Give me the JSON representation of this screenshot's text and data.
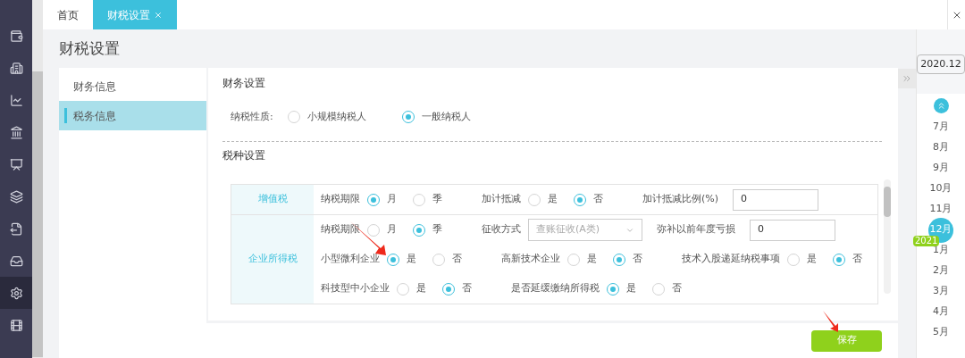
{
  "sidebar": {
    "items": [
      {
        "kind": "bag",
        "selected": false
      },
      {
        "kind": "building",
        "selected": false
      },
      {
        "kind": "chart",
        "selected": false
      },
      {
        "kind": "register",
        "selected": false
      },
      {
        "kind": "board",
        "selected": false
      },
      {
        "kind": "stack",
        "selected": false
      },
      {
        "kind": "export",
        "selected": false
      },
      {
        "kind": "inbox",
        "selected": false
      },
      {
        "kind": "gear",
        "selected": true
      },
      {
        "kind": "video",
        "selected": false
      }
    ]
  },
  "tabs": [
    {
      "label": "首页",
      "selected": false,
      "closable": false
    },
    {
      "label": "财税设置",
      "selected": true,
      "closable": true
    }
  ],
  "page_title": "财税设置",
  "left_menu": [
    {
      "label": "财务信息",
      "selected": false
    },
    {
      "label": "税务信息",
      "selected": true
    }
  ],
  "finance_section": {
    "title": "财务设置",
    "taxpayer_type": {
      "label": "纳税性质:",
      "options": [
        {
          "label": "小规模纳税人",
          "selected": false
        },
        {
          "label": "一般纳税人",
          "selected": true
        }
      ]
    }
  },
  "tax_section": {
    "title": "税种设置",
    "taxes": [
      {
        "name": "增值税",
        "lines": [
          [
            {
              "kind": "radio",
              "label": "纳税期限",
              "options": [
                {
                  "label": "月",
                  "selected": true
                },
                {
                  "label": "季",
                  "selected": false
                }
              ]
            },
            {
              "kind": "radio",
              "label": "加计抵减",
              "options": [
                {
                  "label": "是",
                  "selected": false
                },
                {
                  "label": "否",
                  "selected": true
                }
              ]
            },
            {
              "kind": "input",
              "label": "加计抵减比例(%)",
              "value": "0"
            }
          ]
        ]
      },
      {
        "name": "企业所得税",
        "lines": [
          [
            {
              "kind": "radio",
              "label": "纳税期限",
              "options": [
                {
                  "label": "月",
                  "selected": false
                },
                {
                  "label": "季",
                  "selected": true
                }
              ]
            },
            {
              "kind": "select",
              "label": "征收方式",
              "value": "查账征收(A类)"
            },
            {
              "kind": "input",
              "label": "弥补以前年度亏损",
              "value": "0"
            }
          ],
          [
            {
              "kind": "radio",
              "label": "小型微利企业",
              "options": [
                {
                  "label": "是",
                  "selected": true
                },
                {
                  "label": "否",
                  "selected": false
                }
              ]
            },
            {
              "kind": "radio",
              "label": "高新技术企业",
              "options": [
                {
                  "label": "是",
                  "selected": false
                },
                {
                  "label": "否",
                  "selected": true
                }
              ]
            },
            {
              "kind": "radio",
              "label": "技术入股递延纳税事项",
              "options": [
                {
                  "label": "是",
                  "selected": false
                },
                {
                  "label": "否",
                  "selected": true
                }
              ]
            }
          ],
          [
            {
              "kind": "radio",
              "label": "科技型中小企业",
              "options": [
                {
                  "label": "是",
                  "selected": false
                },
                {
                  "label": "否",
                  "selected": true
                }
              ]
            },
            {
              "kind": "radio",
              "label": "是否延缓缴纳所得税",
              "options": [
                {
                  "label": "是",
                  "selected": true
                },
                {
                  "label": "否",
                  "selected": false
                }
              ]
            }
          ]
        ]
      }
    ]
  },
  "save_button": "保存",
  "calendar": {
    "period": "2020.12",
    "months_before": [
      {
        "label": "7月",
        "selected": false
      },
      {
        "label": "8月",
        "selected": false
      },
      {
        "label": "9月",
        "selected": false
      },
      {
        "label": "10月",
        "selected": false
      },
      {
        "label": "11月",
        "selected": false
      },
      {
        "label": "12月",
        "selected": true
      }
    ],
    "year_badge": "2021",
    "months_after": [
      {
        "label": "1月",
        "selected": false
      },
      {
        "label": "2月",
        "selected": false
      },
      {
        "label": "3月",
        "selected": false
      },
      {
        "label": "4月",
        "selected": false
      },
      {
        "label": "5月",
        "selected": false
      }
    ]
  }
}
